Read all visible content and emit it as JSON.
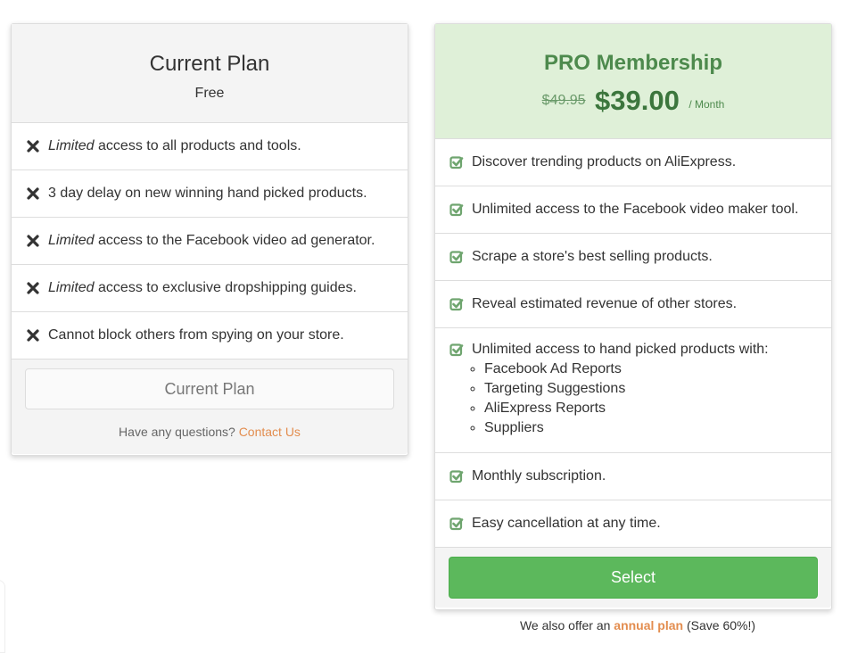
{
  "free_plan": {
    "title": "Current Plan",
    "subtitle": "Free",
    "features": [
      {
        "em": "Limited",
        "text": " access to all products and tools.",
        "icon": "times-icon"
      },
      {
        "em": "",
        "text": "3 day delay on new winning hand picked products.",
        "icon": "times-icon"
      },
      {
        "em": "Limited",
        "text": " access to the Facebook video ad generator.",
        "icon": "times-icon"
      },
      {
        "em": "Limited",
        "text": " access to exclusive dropshipping guides.",
        "icon": "times-icon"
      },
      {
        "em": "",
        "text": "Cannot block others from spying on your store.",
        "icon": "times-icon"
      }
    ],
    "button_label": "Current Plan",
    "questions_text": "Have any questions? ",
    "contact_link": "Contact Us"
  },
  "pro_plan": {
    "title": "PRO Membership",
    "old_price": "$49.95",
    "price": "$39.00",
    "period": "/ Month",
    "features": [
      "Discover trending products on AliExpress.",
      "Unlimited access to the Facebook video maker tool.",
      "Scrape a store's best selling products.",
      "Reveal estimated revenue of other stores.",
      "Unlimited access to hand picked products with:",
      "Monthly subscription.",
      "Easy cancellation at any time."
    ],
    "sub_features": [
      "Facebook Ad Reports",
      "Targeting Suggestions",
      "AliExpress Reports",
      "Suppliers"
    ],
    "button_label": "Select"
  },
  "annual": {
    "prefix": "We also offer an ",
    "link": "annual plan",
    "suffix": " (Save 60%!)"
  },
  "colors": {
    "accent_green": "#5cb85c",
    "pro_header_bg": "#dff0d8",
    "link_orange": "#e38d4f"
  }
}
